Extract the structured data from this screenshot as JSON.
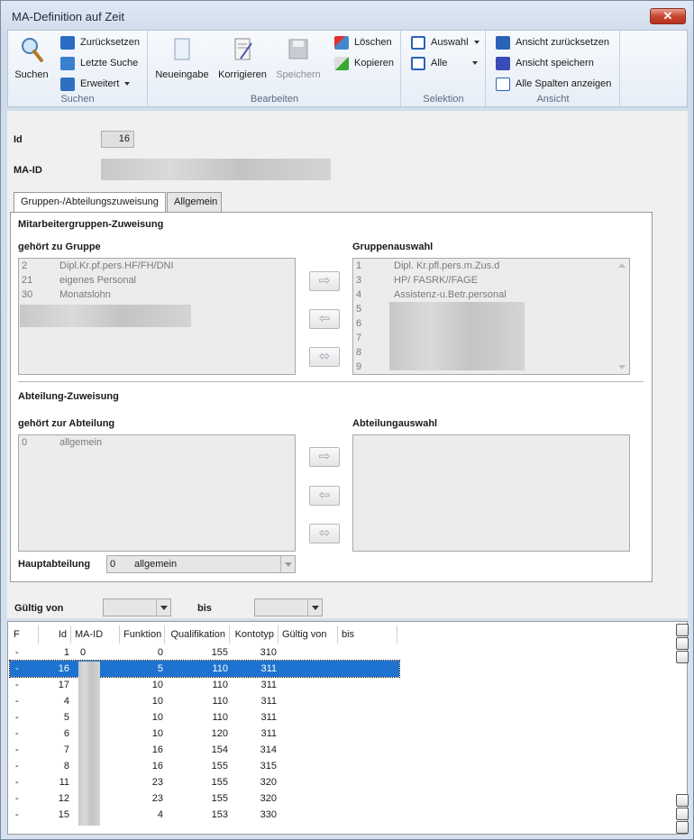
{
  "window": {
    "title": "MA-Definition auf Zeit",
    "close_glyph": "✕"
  },
  "ribbon": {
    "groups": {
      "suchen": "Suchen",
      "bearbeiten": "Bearbeiten",
      "selektion": "Selektion",
      "ansicht": "Ansicht"
    },
    "suchen_btn": "Suchen",
    "zuruecksetzen": "Zurücksetzen",
    "letzte_suche": "Letzte Suche",
    "erweitert": "Erweitert",
    "neueingabe": "Neueingabe",
    "korrigieren": "Korrigieren",
    "speichern": "Speichern",
    "loeschen": "Löschen",
    "kopieren": "Kopieren",
    "auswahl": "Auswahl",
    "alle": "Alle",
    "ansicht_zuruecksetzen": "Ansicht zurücksetzen",
    "ansicht_speichern": "Ansicht speichern",
    "alle_spalten": "Alle Spalten anzeigen"
  },
  "form": {
    "id_label": "Id",
    "id_value": "16",
    "maid_label": "MA-ID",
    "tabs": [
      "Gruppen-/Abteilungszuweisung",
      "Allgemein"
    ],
    "gruppen_section": "Mitarbeitergruppen-Zuweisung",
    "gehoert_gruppe": "gehört zu Gruppe",
    "gruppenauswahl": "Gruppenauswahl",
    "gruppe_items": [
      {
        "id": "2",
        "name": "Dipl.Kr.pf.pers.HF/FH/DNI"
      },
      {
        "id": "21",
        "name": "eigenes Personal"
      },
      {
        "id": "30",
        "name": "Monatslohn"
      }
    ],
    "auswahl_items": [
      {
        "id": "1",
        "name": "Dipl. Kr.pfl.pers.m.Zus.d"
      },
      {
        "id": "3",
        "name": "HP/ FASRK//FAGE"
      },
      {
        "id": "4",
        "name": "Assistenz-u.Betr.personal"
      },
      {
        "id": "5",
        "name": ""
      },
      {
        "id": "6",
        "name": ""
      },
      {
        "id": "7",
        "name": ""
      },
      {
        "id": "8",
        "name": ""
      },
      {
        "id": "9",
        "name": ""
      }
    ],
    "abteilung_section": "Abteilung-Zuweisung",
    "gehoert_abteilung": "gehört zur Abteilung",
    "abteilungsauswahl": "Abteilungauswahl",
    "abteilung_items": [
      {
        "id": "0",
        "name": "allgemein"
      }
    ],
    "hauptabteilung_label": "Hauptabteilung",
    "hauptabteilung_id": "0",
    "hauptabteilung_value": "allgemein",
    "gueltig_von_label": "Gültig von",
    "bis_label": "bis",
    "arrows": {
      "right": "⇨",
      "left": "⇦",
      "both": "⬄"
    }
  },
  "grid": {
    "columns": [
      "F",
      "Id",
      "MA-ID",
      "Funktion",
      "Qualifikation",
      "Kontotyp",
      "Gültig von",
      "bis"
    ],
    "rows": [
      {
        "f": "-",
        "id": "1",
        "maid": "0",
        "funktion": "0",
        "qual": "155",
        "konto": "310"
      },
      {
        "f": "-",
        "id": "16",
        "maid": "",
        "funktion": "5",
        "qual": "110",
        "konto": "311",
        "selected": true
      },
      {
        "f": "-",
        "id": "17",
        "maid": "",
        "funktion": "10",
        "qual": "110",
        "konto": "311"
      },
      {
        "f": "-",
        "id": "4",
        "maid": "",
        "funktion": "10",
        "qual": "110",
        "konto": "311"
      },
      {
        "f": "-",
        "id": "5",
        "maid": "",
        "funktion": "10",
        "qual": "110",
        "konto": "311"
      },
      {
        "f": "-",
        "id": "6",
        "maid": "",
        "funktion": "10",
        "qual": "120",
        "konto": "311"
      },
      {
        "f": "-",
        "id": "7",
        "maid": "",
        "funktion": "16",
        "qual": "154",
        "konto": "314"
      },
      {
        "f": "-",
        "id": "8",
        "maid": "",
        "funktion": "16",
        "qual": "155",
        "konto": "315"
      },
      {
        "f": "-",
        "id": "11",
        "maid": "",
        "funktion": "23",
        "qual": "155",
        "konto": "320"
      },
      {
        "f": "-",
        "id": "12",
        "maid": "",
        "funktion": "23",
        "qual": "155",
        "konto": "320"
      },
      {
        "f": "-",
        "id": "15",
        "maid": "",
        "funktion": "4",
        "qual": "153",
        "konto": "330"
      }
    ]
  }
}
